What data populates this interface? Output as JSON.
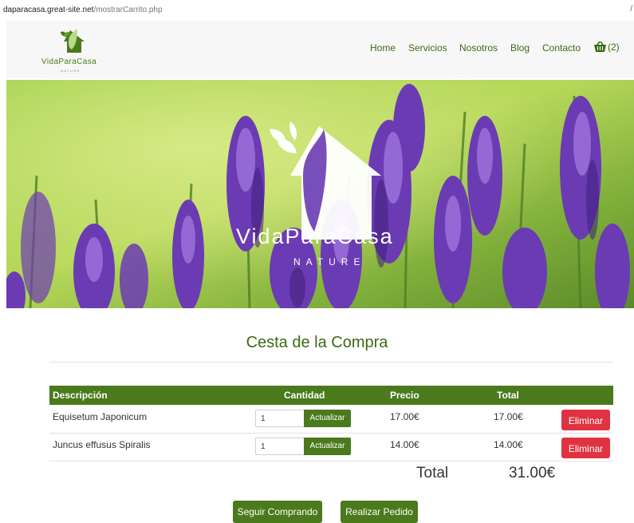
{
  "browser": {
    "url_host": "daparacasa.great-site.net",
    "url_path": "/mostrarCarrito.php",
    "edge_char": "/"
  },
  "brand": {
    "name": "VidaParaCasa",
    "tagline": "NATURE",
    "color": "#4a7a1c"
  },
  "nav": {
    "items": [
      "Home",
      "Servicios",
      "Nosotros",
      "Blog",
      "Contacto"
    ],
    "cart_icon": "basket-icon",
    "cart_count": "(2)"
  },
  "hero": {
    "logo_text": "VidaParaCasa",
    "logo_sub": "NATURE"
  },
  "cart": {
    "title": "Cesta de la Compra",
    "columns": [
      "Descripción",
      "Cantidad",
      "Precio",
      "Total"
    ],
    "rows": [
      {
        "description": "Equisetum Japonicum",
        "quantity": "1",
        "update_label": "Actualizar",
        "price": "17.00€",
        "total": "17.00€",
        "delete_label": "Eliminar"
      },
      {
        "description": "Juncus effusus Spiralis",
        "quantity": "1",
        "update_label": "Actualizar",
        "price": "14.00€",
        "total": "14.00€",
        "delete_label": "Eliminar"
      }
    ],
    "total_label": "Total",
    "total_value": "31.00€"
  },
  "actions": {
    "continue_label": "Seguir Comprando",
    "order_label": "Realizar Pedido"
  },
  "colors": {
    "accent": "#4a7a1c",
    "danger": "#e03342"
  }
}
